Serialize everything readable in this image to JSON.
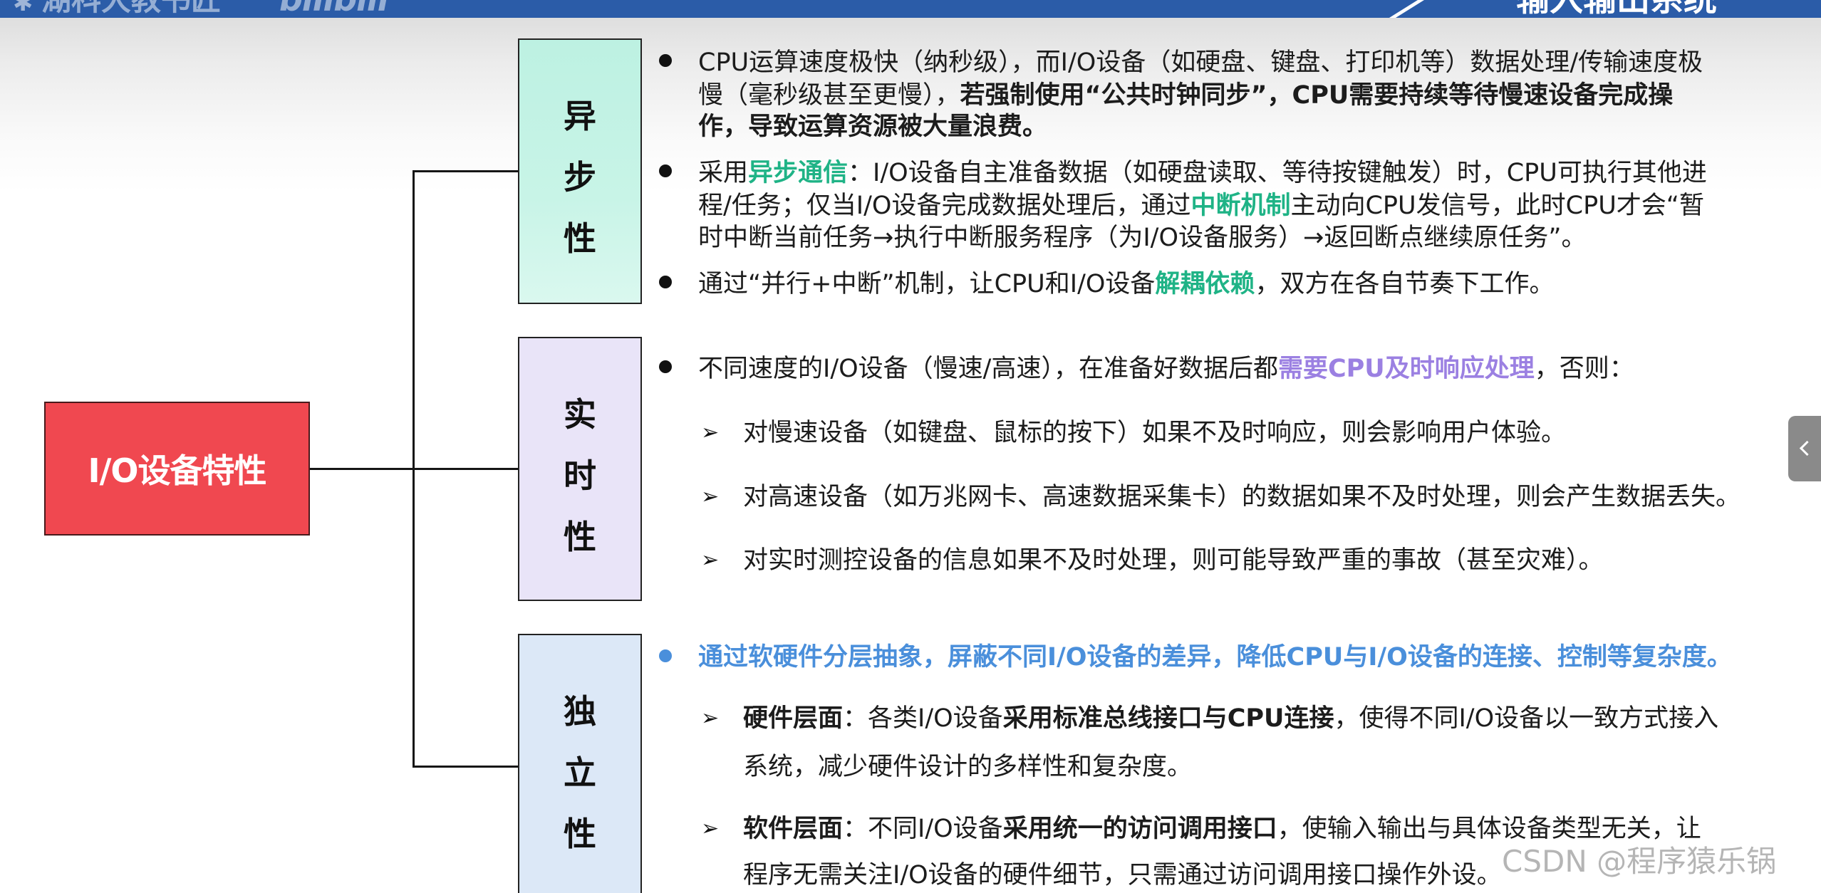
{
  "header": {
    "channel_watermark": "湖科大教书匠",
    "platform_logo": "bilibili",
    "chapter_tab": "输入输出系统"
  },
  "colors": {
    "header_blue": "#2b5ca8",
    "root_fill": "#f04850",
    "async_fill": "#c8f4e7",
    "realtime_fill": "#e9e4f8",
    "independence_fill": "#dce8f7",
    "green_highlight": "#1fb386",
    "purple_highlight": "#9b80e2",
    "blue_highlight": "#4a8fdb"
  },
  "icons": {
    "bullet": "bullet-dot-icon",
    "sub_bullet": "arrow-bullet-icon",
    "side_toggle": "chevron-left-icon"
  },
  "root_node": {
    "label": "I/O设备特性"
  },
  "async": {
    "title": "异步性",
    "points": [
      {
        "l1": "CPU运算速度极快（纳秒级），而I/O设备（如硬盘、键盘、打印机等）数据处理/传输速度极",
        "l2a": "慢（毫秒级甚至更慢），",
        "l2b": "若强制使用“公共时钟同步”，CPU需要持续等待慢速设备完成操",
        "l3": "作，导致运算资源被大量浪费。"
      },
      {
        "l1a": "采用",
        "l1b": "异步通信",
        "l1c": "：I/O设备自主准备数据（如硬盘读取、等待按键触发）时，CPU可执行其他进",
        "l2a": "程/任务；仅当I/O设备完成数据处理后，通过",
        "l2b": "中断机制",
        "l2c": "主动向CPU发信号，此时CPU才会“暂",
        "l3": "时中断当前任务→执行中断服务程序（为I/O设备服务）→返回断点继续原任务”。"
      },
      {
        "l1a": "通过“并行+中断”机制，让CPU和I/O设备",
        "l1b": "解耦依赖",
        "l1c": "，双方在各自节奏下工作。"
      }
    ]
  },
  "realtime": {
    "title": "实时性",
    "point": {
      "l1a": "不同速度的I/O设备（慢速/高速），在准备好数据后都",
      "l1b": "需要CPU及时响应处理",
      "l1c": "，否则："
    },
    "sub_points": [
      "对慢速设备（如键盘、鼠标的按下）如果不及时响应，则会影响用户体验。",
      "对高速设备（如万兆网卡、高速数据采集卡）的数据如果不及时处理，则会产生数据丢失。",
      "对实时测控设备的信息如果不及时处理，则可能导致严重的事故（甚至灾难）。"
    ]
  },
  "independence": {
    "title": "独立性",
    "point": "通过软硬件分层抽象，屏蔽不同I/O设备的差异，降低CPU与I/O设备的连接、控制等复杂度。",
    "sub_points": [
      {
        "l1a": "硬件层面",
        "l1b": "：各类I/O设备",
        "l1c": "采用标准总线接口与CPU连接",
        "l1d": "，使得不同I/O设备以一致方式接入",
        "l2": "系统，减少硬件设计的多样性和复杂度。"
      },
      {
        "l1a": "软件层面",
        "l1b": "：不同I/O设备",
        "l1c": "采用统一的访问调用接口",
        "l1d": "，使输入输出与具体设备类型无关，让",
        "l2": "程序无需关注I/O设备的硬件细节，只需通过访问调用接口操作外设。"
      }
    ]
  },
  "watermark": "CSDN @程序猿乐锅"
}
